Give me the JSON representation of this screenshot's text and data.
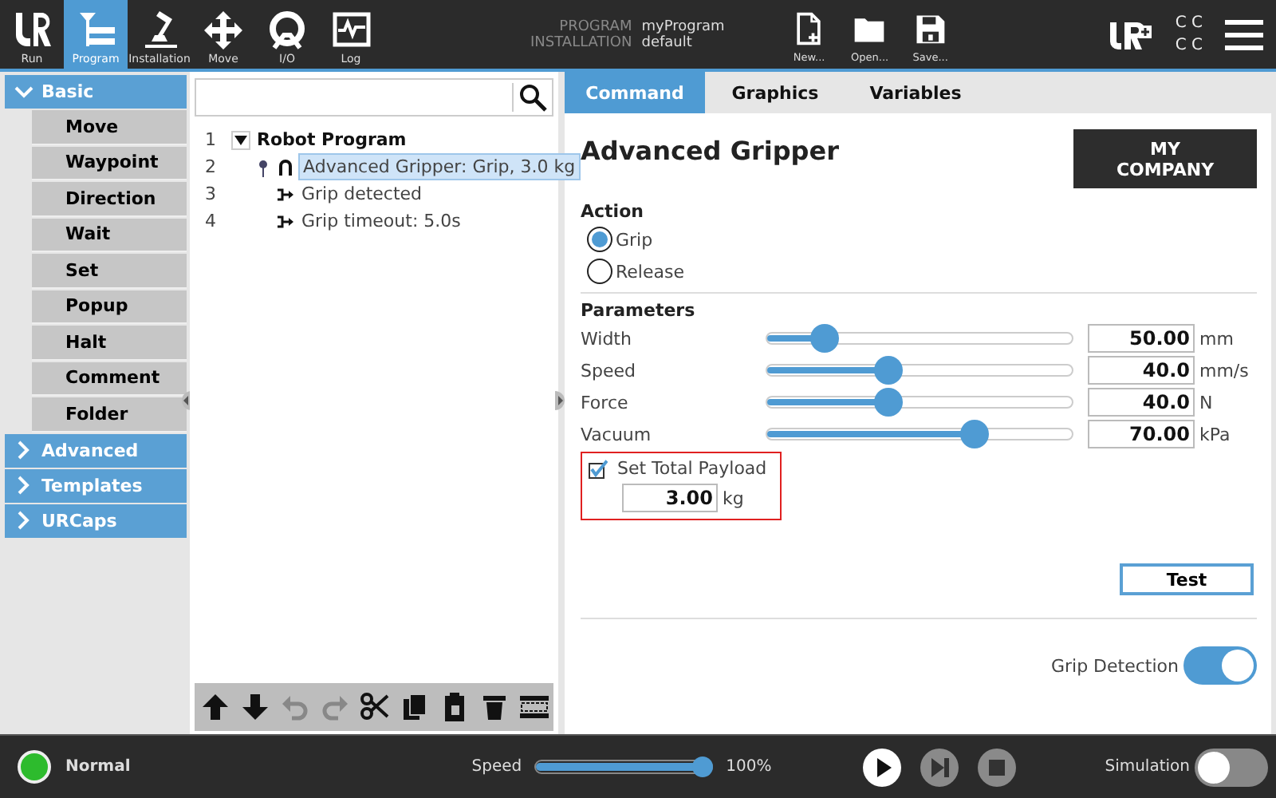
{
  "top_bar": {
    "nav": [
      {
        "label": "Run",
        "selected": false
      },
      {
        "label": "Program",
        "selected": true
      },
      {
        "label": "Installation",
        "selected": false
      },
      {
        "label": "Move",
        "selected": false
      },
      {
        "label": "I/O",
        "selected": false
      },
      {
        "label": "Log",
        "selected": false
      }
    ],
    "program_label": "PROGRAM",
    "program_value": "myProgram",
    "installation_label": "INSTALLATION",
    "installation_value": "default",
    "file_actions": [
      "New...",
      "Open...",
      "Save..."
    ],
    "status_glyphs": [
      "C C",
      "C C"
    ]
  },
  "sidebar": {
    "groups": [
      {
        "label": "Basic",
        "expanded": true,
        "children": [
          {
            "label": "Move"
          },
          {
            "label": "Waypoint"
          },
          {
            "label": "Direction"
          },
          {
            "label": "Wait"
          },
          {
            "label": "Set"
          },
          {
            "label": "Popup"
          },
          {
            "label": "Halt"
          },
          {
            "label": "Comment"
          },
          {
            "label": "Folder"
          }
        ]
      },
      {
        "label": "Advanced",
        "expanded": false
      },
      {
        "label": "Templates",
        "expanded": false
      },
      {
        "label": "URCaps",
        "expanded": false
      }
    ]
  },
  "program_tree": {
    "nodes": [
      {
        "line": "1",
        "label": "Robot Program",
        "kind": "root",
        "expanded": true,
        "selected": false,
        "children": [
          {
            "line": "2",
            "label": "Advanced Gripper: Grip, 3.0 kg",
            "kind": "gripper",
            "selected": true,
            "children": [
              {
                "line": "3",
                "label": "Grip detected",
                "kind": "branch",
                "selected": false
              },
              {
                "line": "4",
                "label": "Grip timeout: 5.0s",
                "kind": "branch",
                "selected": false
              }
            ]
          }
        ]
      }
    ],
    "toolbar": [
      {
        "disabled": false
      },
      {
        "disabled": false
      },
      {
        "disabled": true
      },
      {
        "disabled": true
      },
      {
        "disabled": false
      },
      {
        "disabled": false
      },
      {
        "disabled": false
      },
      {
        "disabled": false
      },
      {
        "disabled": false
      }
    ]
  },
  "tabs": [
    {
      "label": "Command",
      "selected": true
    },
    {
      "label": "Graphics",
      "selected": false
    },
    {
      "label": "Variables",
      "selected": false
    }
  ],
  "command": {
    "title": "Advanced Gripper",
    "logo": "MY COMPANY",
    "action": {
      "label": "Action",
      "options": [
        {
          "label": "Grip",
          "selected": true
        },
        {
          "label": "Release",
          "selected": false
        }
      ]
    },
    "parameters": {
      "label": "Parameters",
      "rows": [
        {
          "name": "Width",
          "level": 0.16,
          "value": "50.00",
          "unit": "mm"
        },
        {
          "name": "Speed",
          "level": 0.39,
          "value": "40.0",
          "unit": "mm/s"
        },
        {
          "name": "Force",
          "level": 0.39,
          "value": "40.0",
          "unit": "N"
        },
        {
          "name": "Vacuum",
          "level": 0.7,
          "value": "70.00",
          "unit": "kPa"
        }
      ]
    },
    "payload": {
      "label": "Set Total Payload",
      "checked": true,
      "highlighted": true,
      "value": "3.00",
      "unit": "kg"
    },
    "test_button": "Test",
    "grip_detection": {
      "label": "Grip Detection",
      "on": true
    }
  },
  "bottom_bar": {
    "status": {
      "label": "Normal",
      "color": "#2dbb2d"
    },
    "speed": {
      "label": "Speed",
      "level": 1.0,
      "reading": "100%"
    },
    "controls": [
      {
        "disabled": false
      },
      {
        "disabled": true
      },
      {
        "disabled": true
      }
    ],
    "simulation": {
      "label": "Simulation",
      "on": false
    }
  }
}
